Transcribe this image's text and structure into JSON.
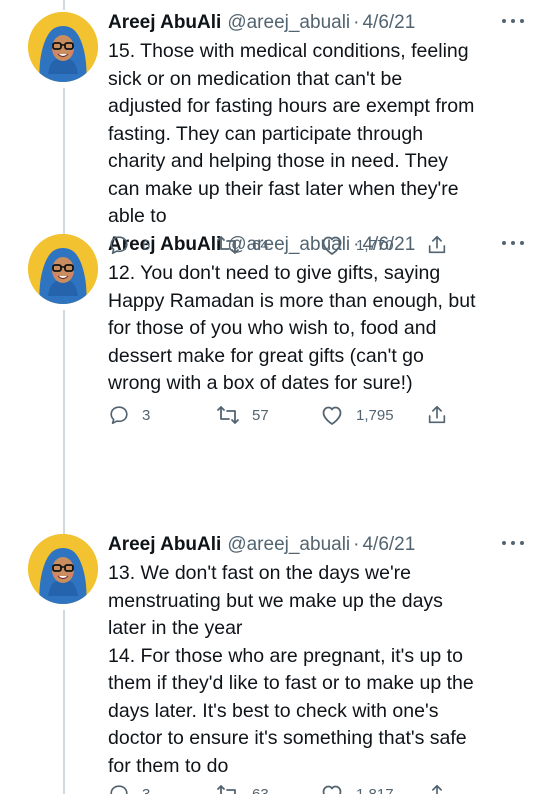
{
  "tweets": [
    {
      "name": "Areej AbuAli",
      "handle": "@areej_abuali",
      "dot": "·",
      "date": "4/6/21",
      "lines": [
        "12. You don't need to give gifts, saying",
        "Happy Ramadan is more than enough, but",
        "for those of you who wish to, food and",
        "dessert make for great gifts (can't go",
        "wrong with a box of dates for sure!)"
      ],
      "replies": "3",
      "retweets": "57",
      "likes": "1,795"
    },
    {
      "name": "Areej AbuAli",
      "handle": "@areej_abuali",
      "dot": "·",
      "date": "4/6/21",
      "lines": [
        "13. We don't fast on the days we're",
        "menstruating but we make up the days",
        "later in the year",
        "14. For those who are pregnant, it's up to",
        "them if they'd like to fast or to make up the",
        "days later. It's best to check with one's",
        "doctor to ensure it's something that's safe",
        "for them to do"
      ],
      "replies": "3",
      "retweets": "63",
      "likes": "1,817"
    },
    {
      "name": "Areej AbuAli",
      "handle": "@areej_abuali",
      "dot": "·",
      "date": "4/6/21",
      "lines": [
        "15. Those with medical conditions, feeling",
        "sick or on medication that can't be",
        "adjusted for fasting hours are exempt from",
        "fasting. They can participate through",
        "charity and helping those in need. They",
        "can make up their fast later when they're",
        "able to"
      ],
      "replies": "6",
      "retweets": "64",
      "likes": "1,770"
    }
  ],
  "colors": {
    "text": "#0f1419",
    "secondary": "#536471",
    "thread_line": "#cfd9de",
    "avatar_bg": "#f2c230",
    "hijab": "#2f74c0"
  },
  "icons": [
    "reply-icon",
    "retweet-icon",
    "like-icon",
    "share-icon",
    "more-icon"
  ]
}
